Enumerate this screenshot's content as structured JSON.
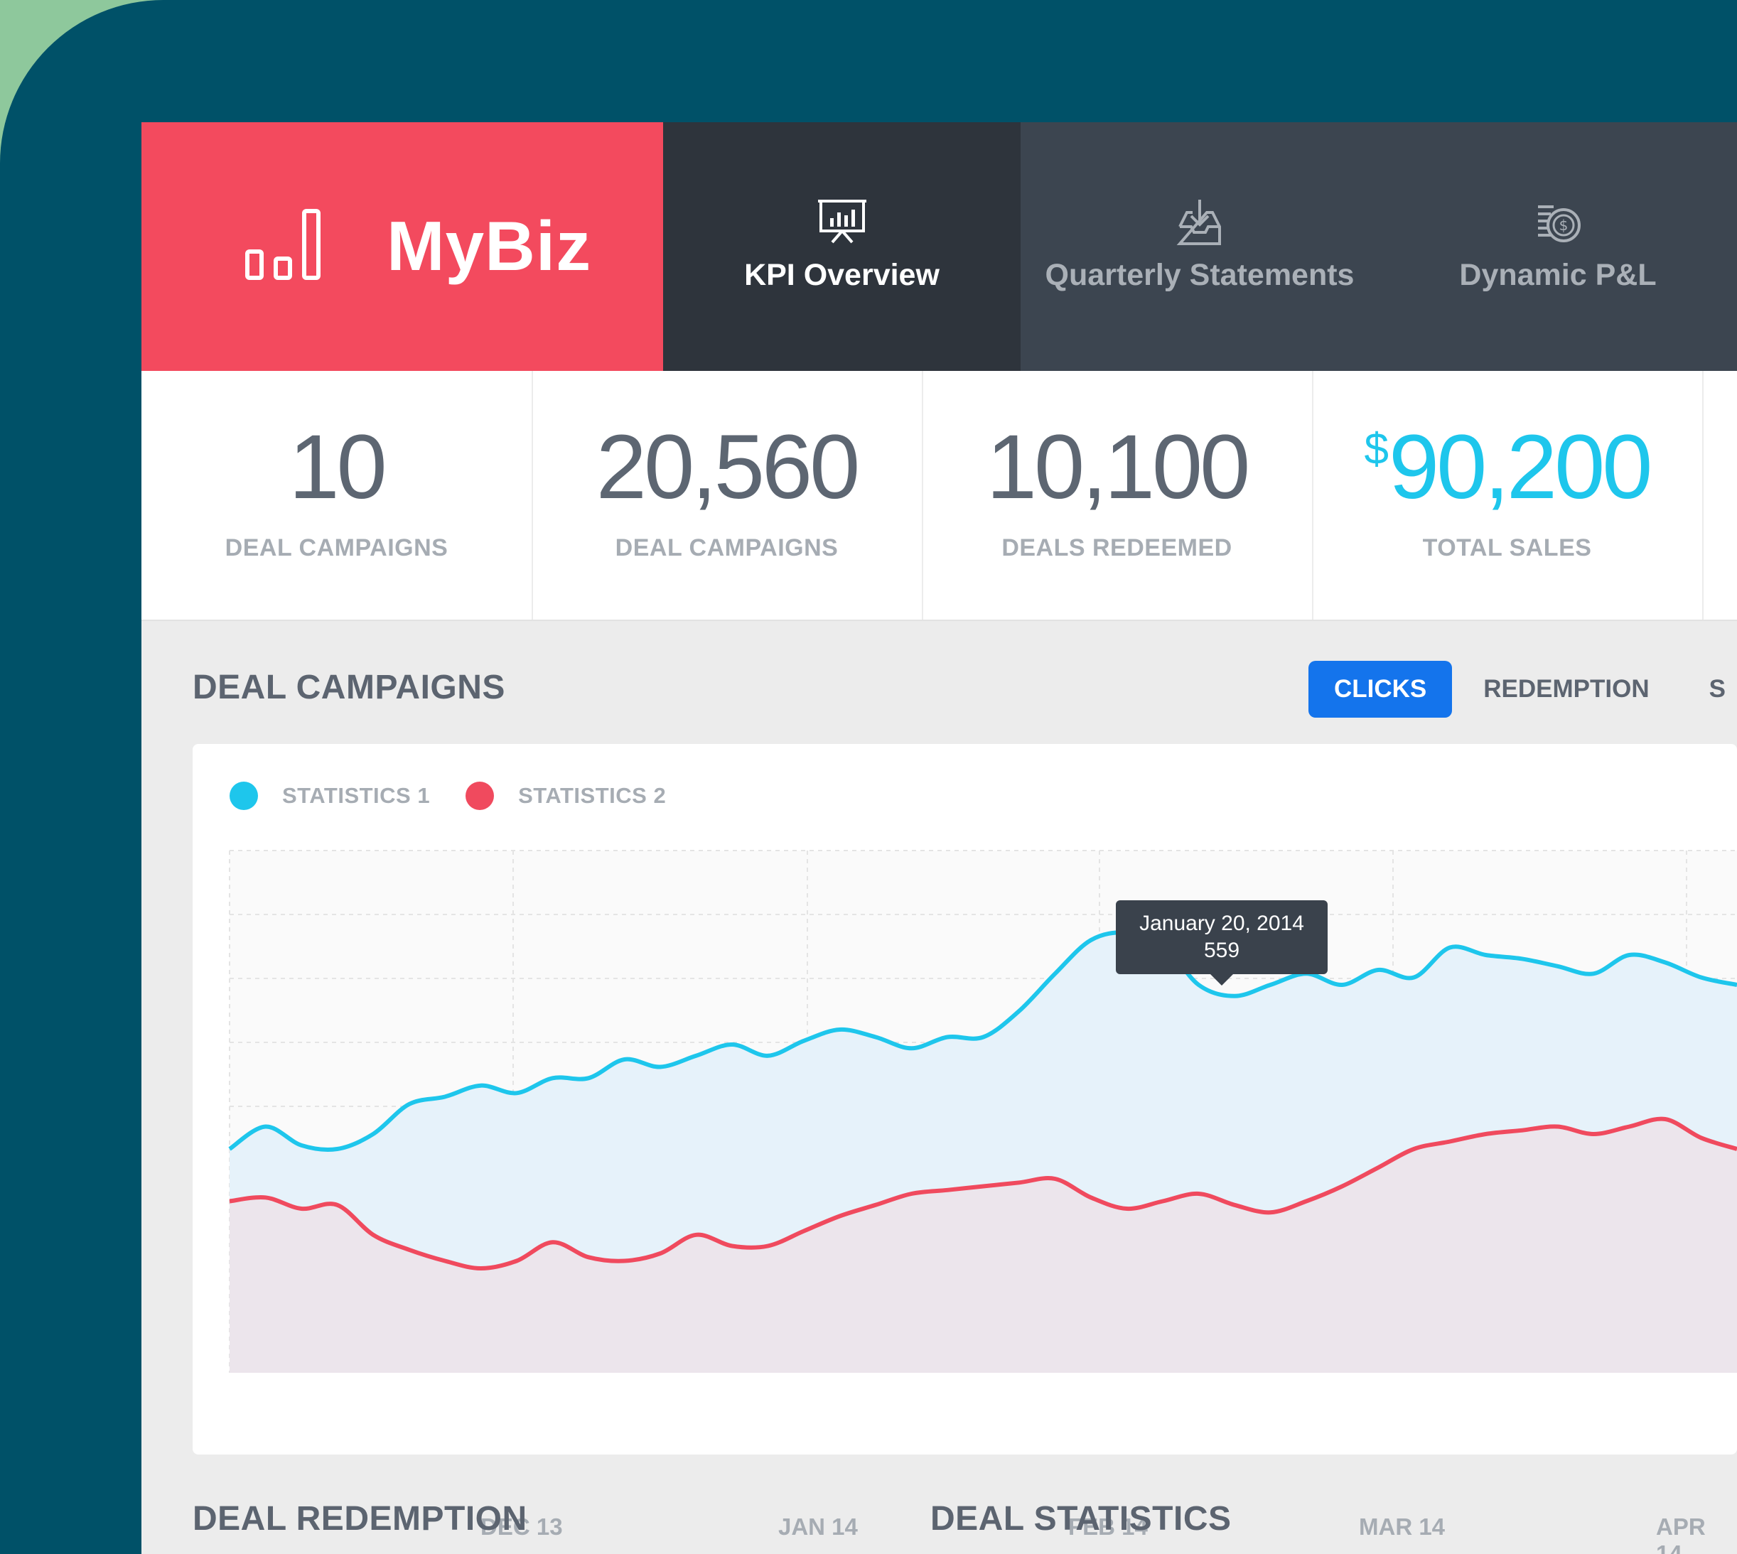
{
  "brand": {
    "name": "MyBiz",
    "color": "#f34a5e"
  },
  "nav": {
    "tabs": [
      {
        "label": "KPI Overview",
        "icon": "presentation-chart-icon",
        "active": true
      },
      {
        "label": "Quarterly Statements",
        "icon": "inbox-download-icon",
        "active": false
      },
      {
        "label": "Dynamic P&L",
        "icon": "coins-dollar-icon",
        "active": false
      }
    ]
  },
  "stats": [
    {
      "value": "10",
      "label": "DEAL CAMPAIGNS"
    },
    {
      "value": "20,560",
      "label": "DEAL CAMPAIGNS"
    },
    {
      "value": "10,100",
      "label": "DEALS REDEEMED"
    },
    {
      "currency": "$",
      "value": "90,200",
      "label": "TOTAL SALES"
    }
  ],
  "deal_campaigns": {
    "title": "DEAL CAMPAIGNS",
    "toggle": {
      "clicks": "CLICKS",
      "redemption": "REDEMPTION",
      "partial": "S"
    },
    "tooltip": {
      "date": "January 20, 2014",
      "value": "559"
    }
  },
  "sections": {
    "redemption": "DEAL REDEMPTION",
    "statistics": "DEAL STATISTICS"
  },
  "colors": {
    "stat1": "#1ec6ec",
    "stat2": "#f04a5e",
    "active_button": "#1474ec"
  },
  "chart_data": {
    "type": "area",
    "x_tick_labels": [
      "DEC 13",
      "JAN 14",
      "FEB 14",
      "MAR 14",
      "APR 14"
    ],
    "legend": [
      "STATISTICS 1",
      "STATISTICS 2"
    ],
    "grid": true,
    "legend_position": "top-left",
    "series": [
      {
        "name": "STATISTICS 1",
        "color": "#1ec6ec",
        "values": [
          300,
          330,
          305,
          300,
          320,
          360,
          370,
          385,
          375,
          395,
          395,
          420,
          410,
          425,
          440,
          425,
          445,
          460,
          450,
          435,
          450,
          450,
          485,
          535,
          580,
          590,
          575,
          520,
          505,
          520,
          535,
          520,
          540,
          530,
          570,
          560,
          555,
          545,
          535,
          560,
          550,
          530,
          520
        ]
      },
      {
        "name": "STATISTICS 2",
        "color": "#f04a5e",
        "values": [
          230,
          235,
          220,
          225,
          185,
          165,
          150,
          140,
          150,
          175,
          155,
          150,
          160,
          185,
          170,
          170,
          190,
          210,
          225,
          240,
          245,
          250,
          255,
          260,
          235,
          220,
          230,
          240,
          225,
          215,
          230,
          250,
          275,
          300,
          310,
          320,
          325,
          330,
          320,
          330,
          340,
          315,
          300
        ]
      }
    ]
  }
}
